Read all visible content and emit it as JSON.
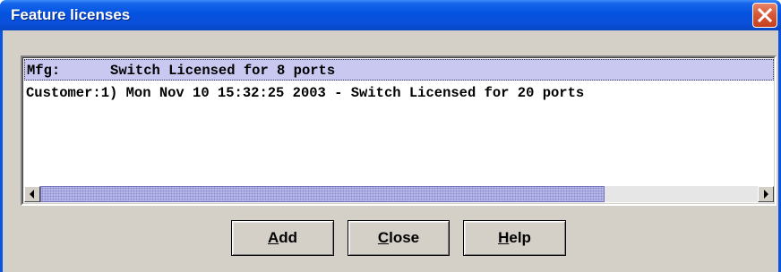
{
  "window": {
    "title": "Feature licenses",
    "close_icon": "close-x-icon"
  },
  "license_list": {
    "items": [
      {
        "text": "Mfg:      Switch Licensed for 8 ports",
        "selected": true
      },
      {
        "text": "Customer:1) Mon Nov 10 15:32:25 2003 - Switch Licensed for 20 ports",
        "selected": false
      }
    ],
    "scrollbar": {
      "left_arrow_icon": "arrow-left-icon",
      "right_arrow_icon": "arrow-right-icon"
    }
  },
  "buttons": {
    "add": {
      "mnemonic": "A",
      "rest": "dd"
    },
    "close": {
      "mnemonic": "C",
      "rest": "lose"
    },
    "help": {
      "mnemonic": "H",
      "rest": "elp"
    }
  },
  "colors": {
    "titlebar": "#0452e0",
    "dialog_face": "#d4d0c8",
    "selection": "#c8c8f0",
    "close_button": "#d65a38"
  }
}
